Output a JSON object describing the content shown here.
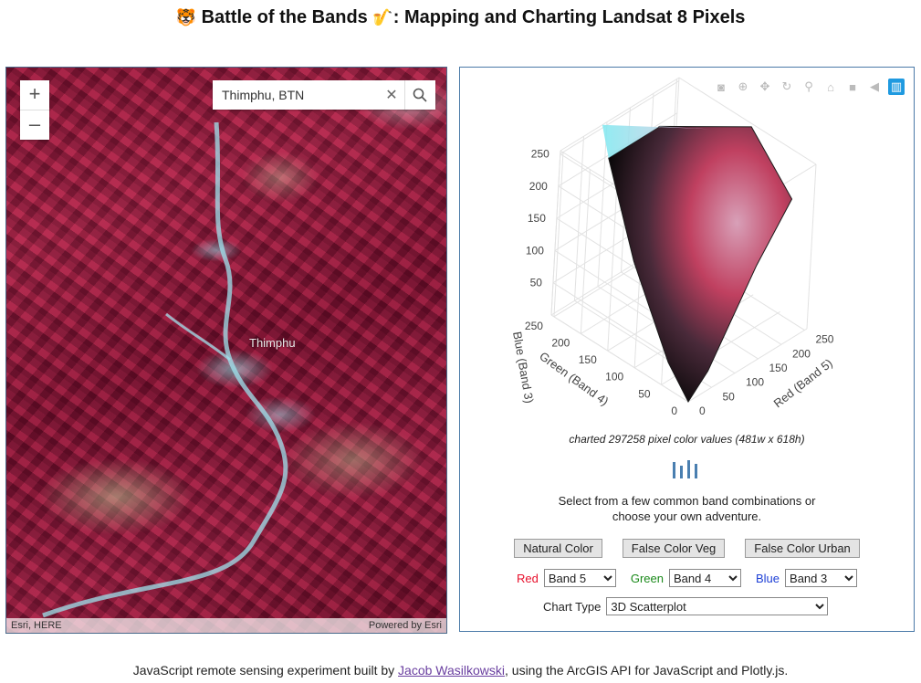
{
  "header": {
    "title": "Battle of the Bands",
    "title_emoji_left": "🐯",
    "title_emoji_right": "🎷",
    "subtitle": ": Mapping and Charting Landsat 8 Pixels"
  },
  "map": {
    "search_value": "Thimphu, BTN",
    "zoom_in_label": "+",
    "zoom_out_label": "–",
    "city_label": "Thimphu",
    "attribution_left": "Esri, HERE",
    "attribution_right": "Powered by Esri"
  },
  "chart_data": {
    "type": "scatter",
    "dimensions": "3d",
    "x_axis": {
      "label": "Red (Band 5)",
      "ticks": [
        0,
        50,
        100,
        150,
        200,
        250
      ],
      "range": [
        0,
        255
      ]
    },
    "y_axis": {
      "label": "Green (Band 4)",
      "ticks": [
        0,
        50,
        100,
        150,
        200,
        250
      ],
      "range": [
        0,
        255
      ]
    },
    "z_axis": {
      "label": "Blue (Band 3)",
      "ticks": [
        50,
        100,
        150,
        200,
        250
      ],
      "range": [
        0,
        255
      ]
    },
    "point_count": 297258,
    "grid": true
  },
  "chart_panel": {
    "caption": "charted 297258 pixel color values (481w x 618h)",
    "instructions_line1": "Select from a few common band combinations or",
    "instructions_line2": "choose your own adventure.",
    "preset_buttons": [
      "Natural Color",
      "False Color Veg",
      "False Color Urban"
    ],
    "red_label": "Red",
    "green_label": "Green",
    "blue_label": "Blue",
    "red_value": "Band 5",
    "green_value": "Band 4",
    "blue_value": "Band 3",
    "chart_type_label": "Chart Type",
    "chart_type_value": "3D Scatterplot",
    "colors": {
      "red": "#e8102c",
      "green": "#1a8a1a",
      "blue": "#1d3fd6"
    }
  },
  "modebar": [
    "camera-icon",
    "zoom-icon",
    "pan-icon",
    "orbit-icon",
    "turntable-icon",
    "home-icon",
    "video-camera-icon",
    "tooltip-icon",
    "plotly-logo-icon"
  ],
  "footer": {
    "text_before": "JavaScript remote sensing experiment built by ",
    "author_link": "Jacob Wasilkowski",
    "text_after": ", using the ArcGIS API for JavaScript and Plotly.js."
  }
}
